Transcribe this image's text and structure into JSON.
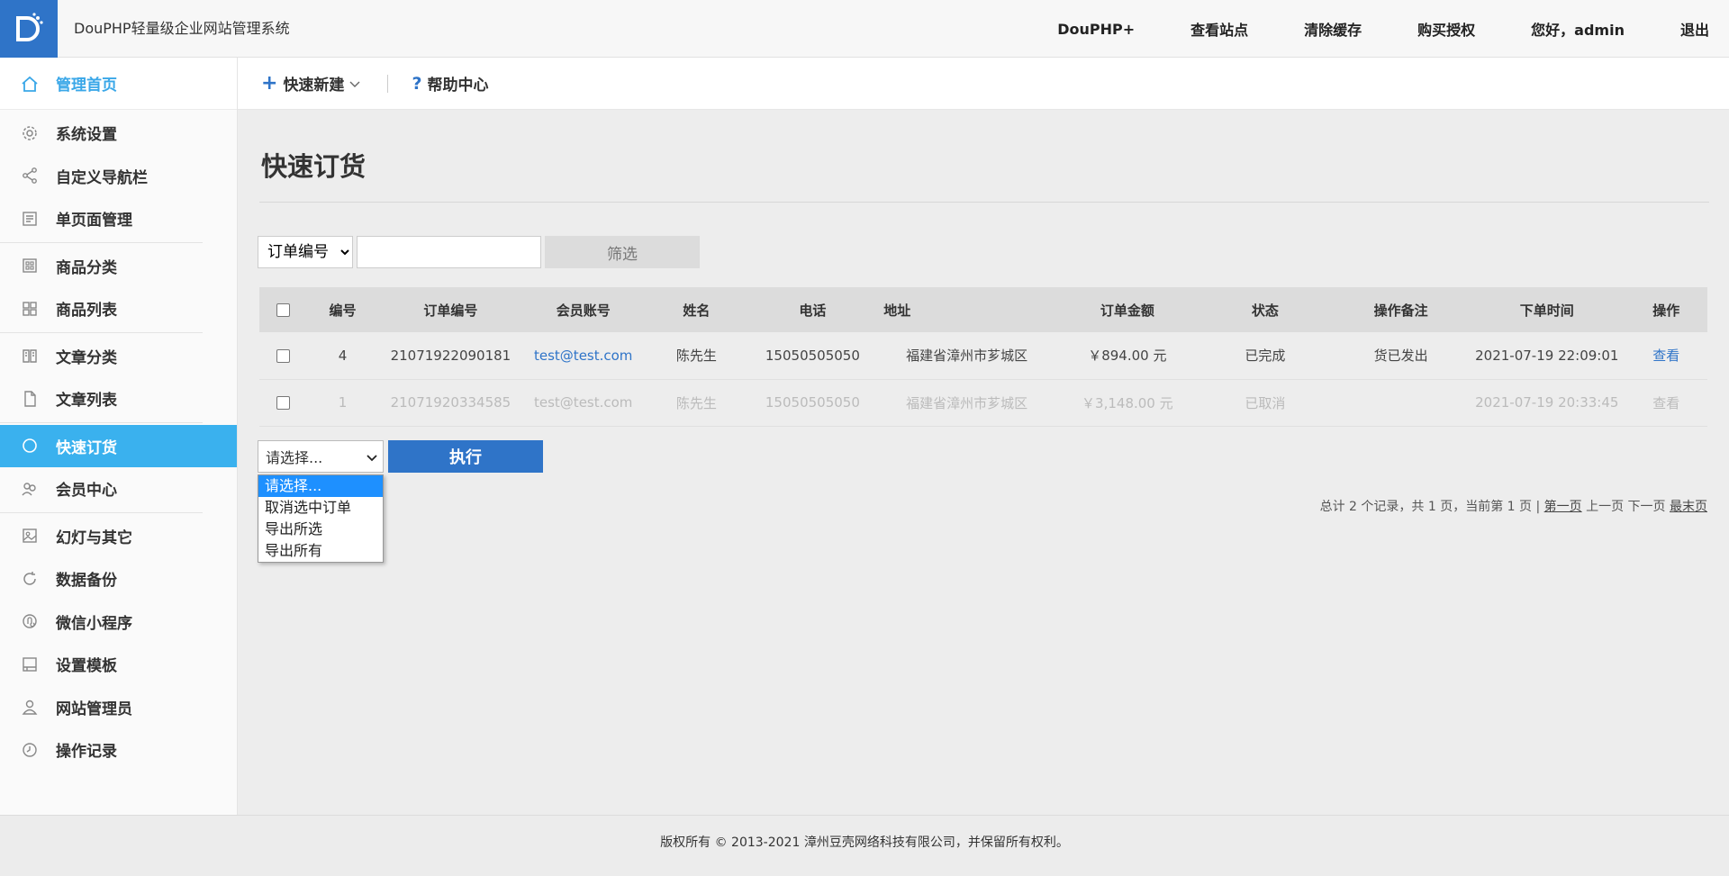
{
  "header": {
    "title": "DouPHP轻量级企业网站管理系统",
    "nav": [
      "DouPHP+",
      "查看站点",
      "清除缓存",
      "购买授权",
      "您好，admin",
      "退出"
    ]
  },
  "sidebar": {
    "home": "管理首页",
    "groups": [
      [
        "系统设置",
        "自定义导航栏",
        "单页面管理"
      ],
      [
        "商品分类",
        "商品列表"
      ],
      [
        "文章分类",
        "文章列表"
      ],
      [
        "快速订货",
        "会员中心"
      ],
      [
        "幻灯与其它",
        "数据备份",
        "微信小程序",
        "设置模板",
        "网站管理员",
        "操作记录"
      ]
    ]
  },
  "subbar": {
    "quick_new": "快速新建",
    "help": "帮助中心"
  },
  "page": {
    "title": "快速订货"
  },
  "filter": {
    "select_value": "订单编号",
    "input_value": "",
    "button": "筛选"
  },
  "table": {
    "headers": [
      "编号",
      "订单编号",
      "会员账号",
      "姓名",
      "电话",
      "地址",
      "订单金额",
      "状态",
      "操作备注",
      "下单时间",
      "操作"
    ],
    "rows": [
      {
        "id": "4",
        "order_no": "21071922090181",
        "account": "test@test.com",
        "name": "陈先生",
        "phone": "15050505050",
        "address": "福建省漳州市芗城区",
        "amount": "￥894.00 元",
        "status": "已完成",
        "note": "货已发出",
        "time": "2021-07-19 22:09:01",
        "action": "查看"
      },
      {
        "id": "1",
        "order_no": "21071920334585",
        "account": "test@test.com",
        "name": "陈先生",
        "phone": "15050505050",
        "address": "福建省漳州市芗城区",
        "amount": "￥3,148.00 元",
        "status": "已取消",
        "note": "",
        "time": "2021-07-19 20:33:45",
        "action": "查看"
      }
    ]
  },
  "actions": {
    "select_value": "请选择...",
    "options": [
      "请选择...",
      "取消选中订单",
      "导出所选",
      "导出所有"
    ],
    "execute": "执行"
  },
  "pager": {
    "summary": "总计 2 个记录，共 1 页，当前第 1 页 |",
    "first": "第一页",
    "prev": "上一页",
    "next": "下一页",
    "last": "最末页"
  },
  "footer": {
    "text": "版权所有 © 2013-2021 漳州豆壳网络科技有限公司，并保留所有权利。"
  },
  "colors": {
    "accent": "#2f74c8",
    "active": "#3ab1ee"
  }
}
